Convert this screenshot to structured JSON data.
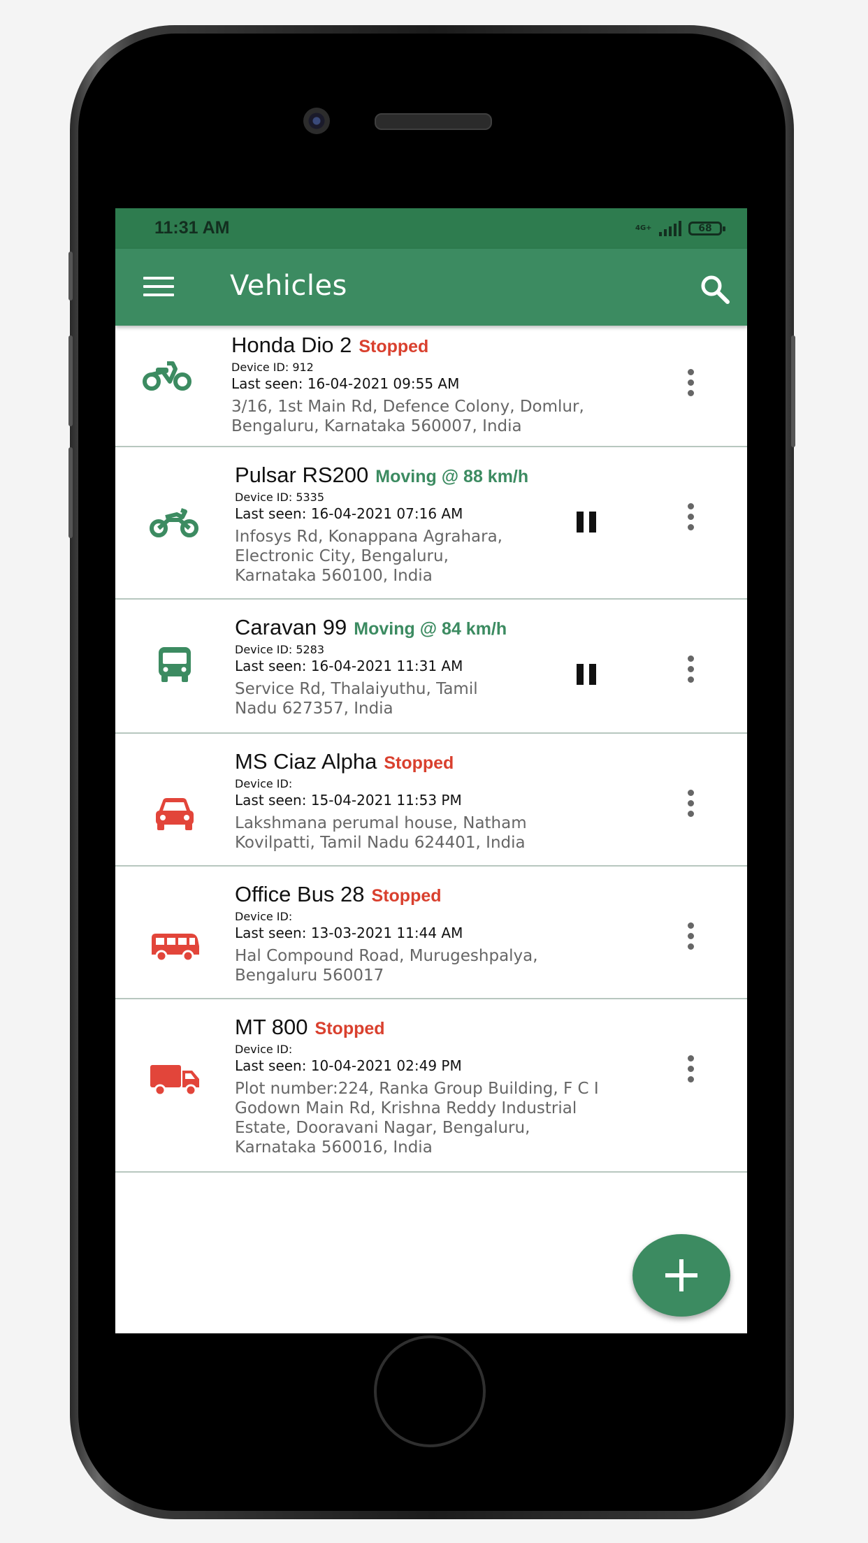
{
  "status_bar": {
    "time": "11:31 AM",
    "network": "4G+",
    "battery": "68"
  },
  "app_bar": {
    "title": "Vehicles",
    "menu_icon": "hamburger-menu-icon",
    "search_icon": "search-icon"
  },
  "colors": {
    "primary": "#3c8b61",
    "status_bar": "#2e7c4f",
    "stopped": "#d9402e",
    "moving": "#3c8b61"
  },
  "vehicles": [
    {
      "name": "Honda Dio 2",
      "status": "Stopped",
      "device_id": "Device ID: 912",
      "last_seen": "Last seen: 16-04-2021 09:55 AM",
      "address": "3/16, 1st Main Rd, Defence Colony, Domlur,\nBengaluru, Karnataka 560007, India",
      "icon": "scooter-icon"
    },
    {
      "name": "Pulsar RS200",
      "status": "Moving @ 88 km/h",
      "device_id": "Device ID: 5335",
      "last_seen": "Last seen: 16-04-2021 07:16 AM",
      "address": "Infosys Rd, Konappana Agrahara,\nElectronic City, Bengaluru,\nKarnataka 560100, India",
      "icon": "motorcycle-icon"
    },
    {
      "name": "Caravan 99",
      "status": "Moving @ 84 km/h",
      "device_id": "Device ID: 5283",
      "last_seen": "Last seen: 16-04-2021 11:31 AM",
      "address": "Service Rd, Thalaiyuthu, Tamil\nNadu 627357, India",
      "icon": "bus-icon"
    },
    {
      "name": "MS Ciaz Alpha",
      "status": "Stopped",
      "device_id": "Device ID:",
      "last_seen": "Last seen: 15-04-2021 11:53 PM",
      "address": "Lakshmana perumal house, Natham\nKovilpatti, Tamil Nadu 624401, India",
      "icon": "car-icon"
    },
    {
      "name": "Office Bus 28",
      "status": "Stopped",
      "device_id": "Device ID:",
      "last_seen": "Last seen: 13-03-2021 11:44 AM",
      "address": "Hal Compound Road, Murugeshpalya,\nBengaluru 560017",
      "icon": "van-icon"
    },
    {
      "name": "MT 800",
      "status": "Stopped",
      "device_id": "Device ID:",
      "last_seen": "Last seen: 10-04-2021 02:49 PM",
      "address": "Plot number:224, Ranka Group Building, F C I\nGodown Main Rd, Krishna Reddy Industrial\nEstate, Dooravani Nagar, Bengaluru,\nKarnataka 560016, India",
      "icon": "truck-icon"
    }
  ],
  "fab": {
    "icon": "plus-icon"
  }
}
